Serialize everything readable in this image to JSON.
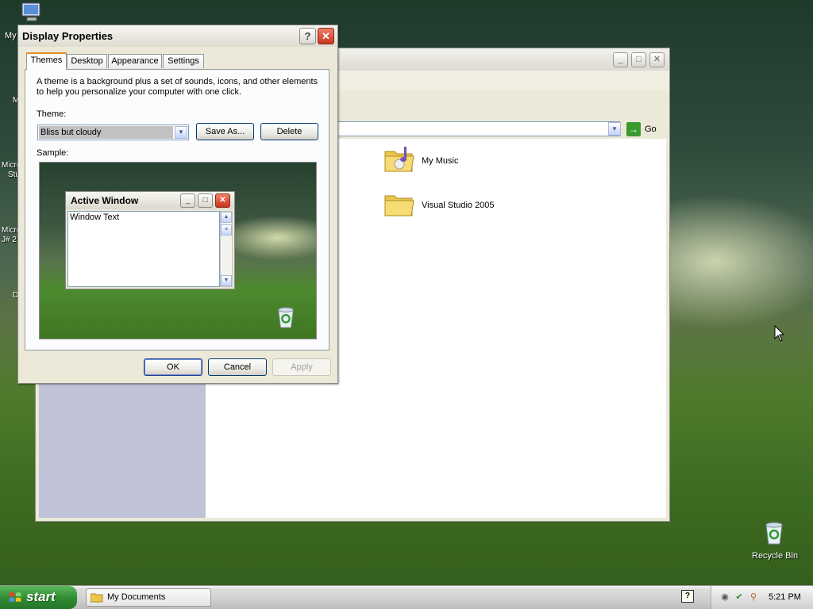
{
  "desktop": {
    "icons": [
      {
        "label": "My",
        "icon": "my-computer-icon"
      },
      {
        "label": "Recycle Bin",
        "icon": "recycle-bin-icon"
      }
    ],
    "fragments": [
      "M",
      "Micro",
      "Stu",
      "Micro",
      "J# 2",
      "D"
    ]
  },
  "explorer": {
    "address_go_label": "Go",
    "items": [
      {
        "label": "My Music",
        "icon": "music-folder-icon"
      },
      {
        "label": "Visual Studio 2005",
        "icon": "folder-icon"
      }
    ],
    "title_buttons": [
      "_",
      "□",
      "✕"
    ]
  },
  "dialog": {
    "title": "Display Properties",
    "help_label": "?",
    "close_label": "✕",
    "tabs": [
      {
        "label": "Themes",
        "active": true
      },
      {
        "label": "Desktop",
        "active": false
      },
      {
        "label": "Appearance",
        "active": false
      },
      {
        "label": "Settings",
        "active": false
      }
    ],
    "description": "A theme is a background plus a set of sounds, icons, and other elements to help you personalize your computer with one click.",
    "theme_label": "Theme:",
    "theme_value": "Bliss but cloudy",
    "save_as_label": "Save As...",
    "delete_label": "Delete",
    "sample_label": "Sample:",
    "sample": {
      "window_title": "Active Window",
      "window_text": "Window Text"
    },
    "ok_label": "OK",
    "cancel_label": "Cancel",
    "apply_label": "Apply"
  },
  "taskbar": {
    "start_label": "start",
    "task_items": [
      {
        "label": "My Documents",
        "icon": "folder-icon"
      }
    ],
    "clock": "5:21 PM",
    "tray_icons": [
      "network-icon",
      "security-icon",
      "search-icon"
    ]
  },
  "colors": {
    "accent": "#e68b2c",
    "start_green": "#2f8a2f",
    "close_red": "#c8351c",
    "selection_gray": "#c1c1c1"
  }
}
